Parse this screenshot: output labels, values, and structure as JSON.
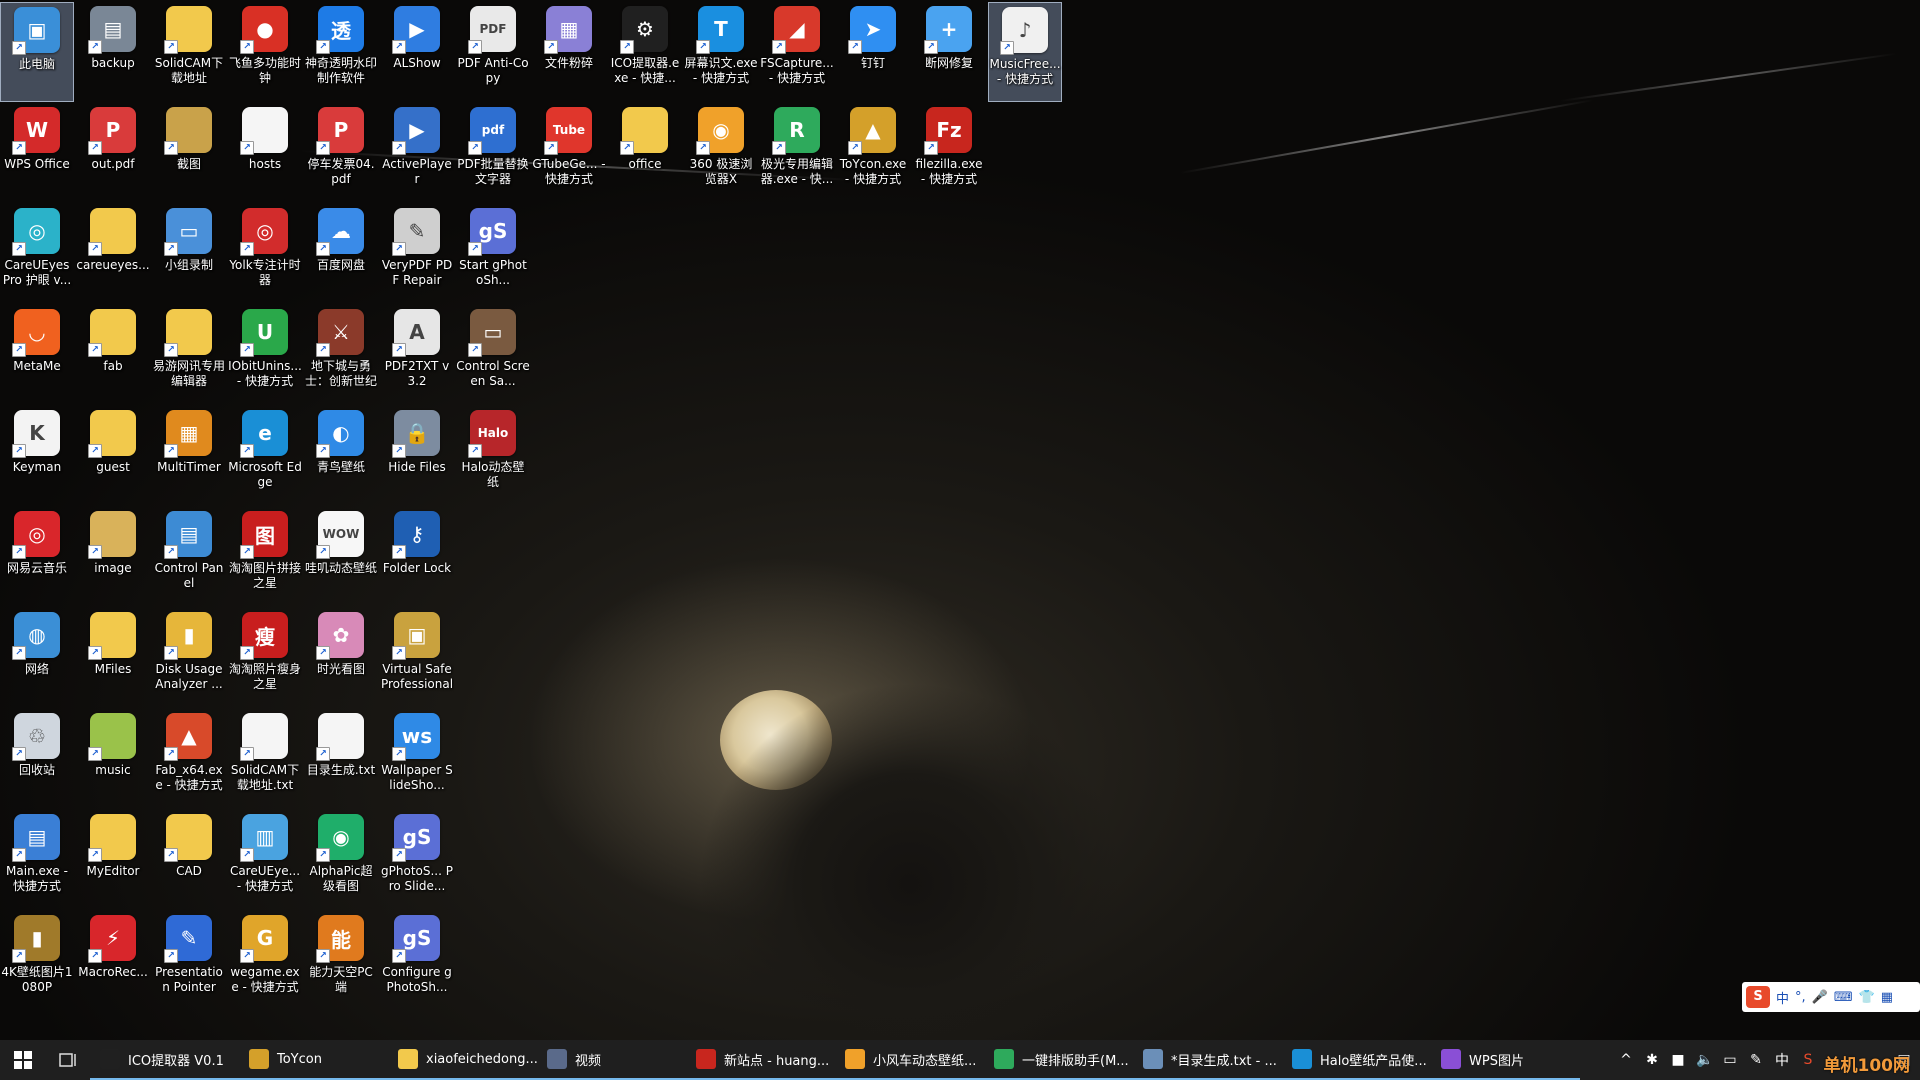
{
  "desktop": {
    "icons": [
      {
        "label": "此电脑",
        "glyph": "▣",
        "color": "#3a8fd8",
        "selected": true
      },
      {
        "label": "backup",
        "glyph": "▤",
        "color": "#7a8796"
      },
      {
        "label": "SolidCAM下载地址",
        "glyph": "",
        "color": "#f2c94c"
      },
      {
        "label": "飞鱼多功能时钟",
        "glyph": "●",
        "color": "#d93025"
      },
      {
        "label": "神奇透明水印制作软件",
        "glyph": "透",
        "color": "#1e7be6"
      },
      {
        "label": "ALShow",
        "glyph": "▶",
        "color": "#2f7de1"
      },
      {
        "label": "PDF Anti-Copy",
        "glyph": "PDF",
        "color": "#e9e9e9"
      },
      {
        "label": "文件粉碎",
        "glyph": "▦",
        "color": "#8a80d6"
      },
      {
        "label": "ICO提取器.exe - 快捷...",
        "glyph": "⚙",
        "color": "#202020"
      },
      {
        "label": "屏幕识文.exe - 快捷方式",
        "glyph": "T",
        "color": "#1a8fe0"
      },
      {
        "label": "FSCapture... - 快捷方式",
        "glyph": "◢",
        "color": "#d8392b"
      },
      {
        "label": "钉钉",
        "glyph": "➤",
        "color": "#2f8ff2"
      },
      {
        "label": "断网修复",
        "glyph": "+",
        "color": "#4aa3f0"
      },
      {
        "label": "MusicFree... - 快捷方式",
        "glyph": "♪",
        "color": "#f0f0f0",
        "selected": true
      },
      {
        "label": "WPS Office",
        "glyph": "W",
        "color": "#d42a2a"
      },
      {
        "label": "out.pdf",
        "glyph": "P",
        "color": "#d93b3b"
      },
      {
        "label": "截图",
        "glyph": "",
        "color": "#c9a24a"
      },
      {
        "label": "hosts",
        "glyph": "",
        "color": "#f5f5f5"
      },
      {
        "label": "停车发票04.pdf",
        "glyph": "P",
        "color": "#d93b3b"
      },
      {
        "label": "ActivePlayer",
        "glyph": "▶",
        "color": "#3570c9"
      },
      {
        "label": "PDF批量替换文字器",
        "glyph": "pdf",
        "color": "#2e6fd1"
      },
      {
        "label": "GTubeGe... - 快捷方式",
        "glyph": "Tube",
        "color": "#e0362c"
      },
      {
        "label": "office",
        "glyph": "",
        "color": "#f2c94c"
      },
      {
        "label": "360 极速浏览器X",
        "glyph": "◉",
        "color": "#f0a12a"
      },
      {
        "label": "极光专用编辑器.exe - 快...",
        "glyph": "R",
        "color": "#2eaa5c"
      },
      {
        "label": "ToYcon.exe - 快捷方式",
        "glyph": "▲",
        "color": "#d4a02a"
      },
      {
        "label": "filezilla.exe - 快捷方式",
        "glyph": "Fz",
        "color": "#c8261e"
      },
      {
        "label": "CareUEyes Pro 护眼 v...",
        "glyph": "◎",
        "color": "#2bb2c9"
      },
      {
        "label": "careueyes...",
        "glyph": "",
        "color": "#f2c94c"
      },
      {
        "label": "小组录制",
        "glyph": "▭",
        "color": "#4a90d9"
      },
      {
        "label": "Yolk专注计时器",
        "glyph": "◎",
        "color": "#d22c2c"
      },
      {
        "label": "百度网盘",
        "glyph": "☁",
        "color": "#3a8be8"
      },
      {
        "label": "VeryPDF PDF Repair",
        "glyph": "✎",
        "color": "#cfcfcf"
      },
      {
        "label": "Start gPhotoSh...",
        "glyph": "gS",
        "color": "#5b6fd6"
      },
      {
        "label": "MetaMe",
        "glyph": "◡",
        "color": "#f0611f"
      },
      {
        "label": "fab",
        "glyph": "",
        "color": "#f2c94c"
      },
      {
        "label": "易游网讯专用编辑器",
        "glyph": "",
        "color": "#f2c94c"
      },
      {
        "label": "IObitUnins... - 快捷方式",
        "glyph": "U",
        "color": "#2aa84a"
      },
      {
        "label": "地下城与勇士：创新世纪",
        "glyph": "⚔",
        "color": "#8b3a2a"
      },
      {
        "label": "PDF2TXT v3.2",
        "glyph": "A",
        "color": "#e6e6e6"
      },
      {
        "label": "Control Screen Sa...",
        "glyph": "▭",
        "color": "#7a5a40"
      },
      {
        "label": "Keyman",
        "glyph": "K",
        "color": "#f3f3f3"
      },
      {
        "label": "guest",
        "glyph": "",
        "color": "#f2c94c"
      },
      {
        "label": "MultiTimer",
        "glyph": "▦",
        "color": "#e08a1e"
      },
      {
        "label": "Microsoft Edge",
        "glyph": "e",
        "color": "#1a8fd6"
      },
      {
        "label": "青鸟壁纸",
        "glyph": "◐",
        "color": "#2f8ae6"
      },
      {
        "label": "Hide Files",
        "glyph": "🔒",
        "color": "#7d8ca0"
      },
      {
        "label": "Halo动态壁纸",
        "glyph": "Halo",
        "color": "#b7262a"
      },
      {
        "label": "网易云音乐",
        "glyph": "◎",
        "color": "#d9262b"
      },
      {
        "label": "image",
        "glyph": "",
        "color": "#d9b25a"
      },
      {
        "label": "Control Panel",
        "glyph": "▤",
        "color": "#3d8bd4"
      },
      {
        "label": "淘淘图片拼接之星",
        "glyph": "图",
        "color": "#c81e1e"
      },
      {
        "label": "哇叽动态壁纸",
        "glyph": "WOW",
        "color": "#f7f7f7"
      },
      {
        "label": "Folder Lock",
        "glyph": "⚷",
        "color": "#1f5fb3"
      },
      {
        "label": "网络",
        "glyph": "◍",
        "color": "#3b8fd6"
      },
      {
        "label": "MFiles",
        "glyph": "",
        "color": "#f2c94c"
      },
      {
        "label": "Disk Usage Analyzer ...",
        "glyph": "▮",
        "color": "#e6b63a"
      },
      {
        "label": "淘淘照片瘦身之星",
        "glyph": "瘦",
        "color": "#c81e1e"
      },
      {
        "label": "时光看图",
        "glyph": "✿",
        "color": "#d88ab8"
      },
      {
        "label": "Virtual Safe Professional",
        "glyph": "▣",
        "color": "#c9a23e"
      },
      {
        "label": "回收站",
        "glyph": "♲",
        "color": "#cfd6de"
      },
      {
        "label": "music",
        "glyph": "",
        "color": "#9ac24a"
      },
      {
        "label": "Fab_x64.exe - 快捷方式",
        "glyph": "▲",
        "color": "#d84a2a"
      },
      {
        "label": "SolidCAM下载地址.txt",
        "glyph": "",
        "color": "#f5f5f5"
      },
      {
        "label": "目录生成.txt",
        "glyph": "",
        "color": "#f5f5f5"
      },
      {
        "label": "Wallpaper SlideSho...",
        "glyph": "ws",
        "color": "#2f8ae6"
      },
      {
        "label": "Main.exe - 快捷方式",
        "glyph": "▤",
        "color": "#3a7fd6"
      },
      {
        "label": "MyEditor",
        "glyph": "",
        "color": "#f2c94c"
      },
      {
        "label": "CAD",
        "glyph": "",
        "color": "#f2c94c"
      },
      {
        "label": "CareUEye... - 快捷方式",
        "glyph": "▥",
        "color": "#4aa3e0"
      },
      {
        "label": "AlphaPic超级看图",
        "glyph": "◉",
        "color": "#1fae6a"
      },
      {
        "label": "gPhotoS... Pro Slide...",
        "glyph": "gS",
        "color": "#5b6fd6"
      },
      {
        "label": "4K壁纸图片1080P",
        "glyph": "▮",
        "color": "#a07a2a"
      },
      {
        "label": "MacroRec...",
        "glyph": "⚡",
        "color": "#d8262b"
      },
      {
        "label": "Presentation Pointer",
        "glyph": "✎",
        "color": "#2f6ad6"
      },
      {
        "label": "wegame.exe - 快捷方式",
        "glyph": "G",
        "color": "#e0a52a"
      },
      {
        "label": "能力天空PC端",
        "glyph": "能",
        "color": "#e07a1e"
      },
      {
        "label": "Configure gPhotoSh...",
        "glyph": "gS",
        "color": "#5b6fd6"
      }
    ]
  },
  "ime": {
    "logo": "S",
    "items": [
      "中",
      "°,",
      "🎤",
      "⌨",
      "👕",
      "▦"
    ]
  },
  "taskbar": {
    "start_icon": "windows-logo",
    "apps": [
      {
        "label": "ICO提取器 V0.1",
        "color": "#202020"
      },
      {
        "label": "ToYcon",
        "color": "#d4a02a"
      },
      {
        "label": "xiaofeichedong...",
        "color": "#f2c94c"
      },
      {
        "label": "视频",
        "color": "#5a6a8a"
      },
      {
        "label": "新站点 - huang...",
        "color": "#c8261e"
      },
      {
        "label": "小风车动态壁纸...",
        "color": "#f0a12a"
      },
      {
        "label": "一键排版助手(M...",
        "color": "#2eaa5c"
      },
      {
        "label": "*目录生成.txt - ...",
        "color": "#6b8fb8"
      },
      {
        "label": "Halo壁纸产品使...",
        "color": "#1a8fd6"
      },
      {
        "label": "WPS图片",
        "color": "#8a4fd6"
      }
    ],
    "tray": {
      "chevron": "^",
      "lang": "中"
    },
    "watermark": "单机100网"
  }
}
